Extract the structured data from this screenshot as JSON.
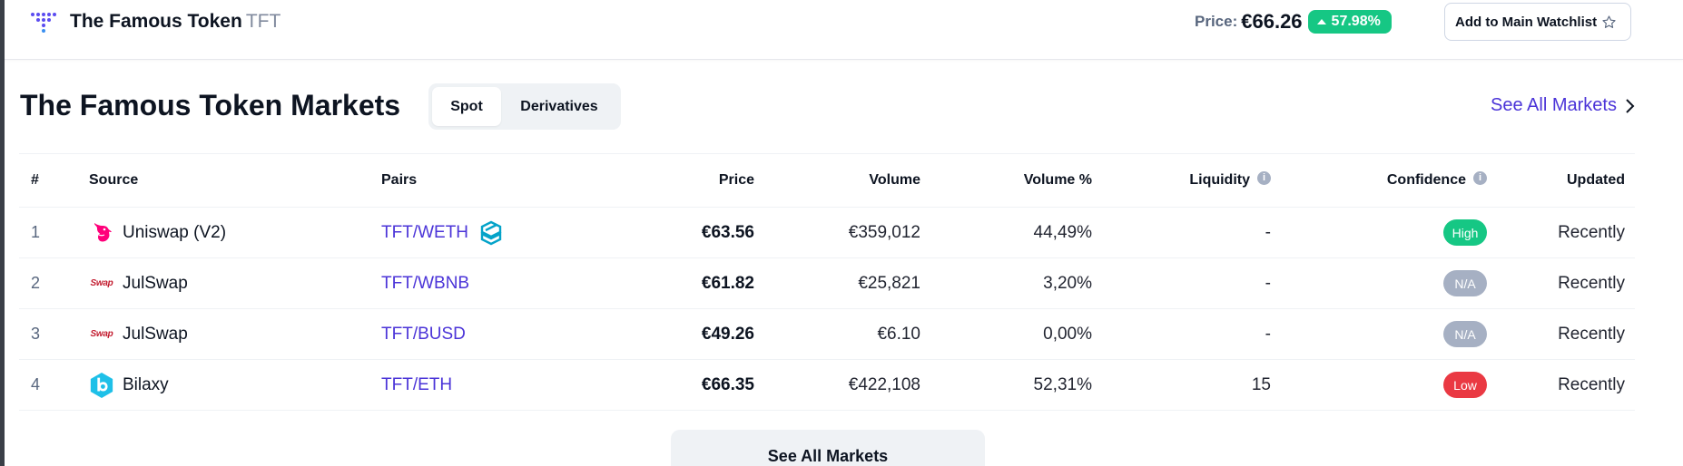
{
  "header": {
    "token_name": "The Famous Token",
    "token_symbol": "TFT",
    "price_label": "Price:",
    "price_value": "€66.26",
    "change_pct": "57.98%",
    "watchlist_label": "Add to Main Watchlist"
  },
  "markets": {
    "title": "The Famous Token Markets",
    "tabs": [
      {
        "label": "Spot",
        "active": true
      },
      {
        "label": "Derivatives",
        "active": false
      }
    ],
    "see_all_label": "See All Markets",
    "columns": {
      "num": "#",
      "source": "Source",
      "pairs": "Pairs",
      "price": "Price",
      "volume": "Volume",
      "volume_pct": "Volume %",
      "liquidity": "Liquidity",
      "confidence": "Confidence",
      "updated": "Updated"
    },
    "rows": [
      {
        "num": "1",
        "source": "Uniswap (V2)",
        "source_icon": "uniswap-unicorn-icon",
        "pair": "TFT/WETH",
        "pair_icon": "dextools-icon",
        "price": "€63.56",
        "volume": "€359,012",
        "volume_pct": "44,49%",
        "liquidity": "-",
        "confidence": "High",
        "confidence_color": "#16c784",
        "updated": "Recently"
      },
      {
        "num": "2",
        "source": "JulSwap",
        "source_icon": "julswap-logo",
        "source_logo_text": "Swap",
        "pair": "TFT/WBNB",
        "price": "€61.82",
        "volume": "€25,821",
        "volume_pct": "3,20%",
        "liquidity": "-",
        "confidence": "N/A",
        "confidence_color": "#a6b0c3",
        "updated": "Recently"
      },
      {
        "num": "3",
        "source": "JulSwap",
        "source_icon": "julswap-logo",
        "source_logo_text": "Swap",
        "pair": "TFT/BUSD",
        "price": "€49.26",
        "volume": "€6.10",
        "volume_pct": "0,00%",
        "liquidity": "-",
        "confidence": "N/A",
        "confidence_color": "#a6b0c3",
        "updated": "Recently"
      },
      {
        "num": "4",
        "source": "Bilaxy",
        "source_icon": "bilaxy-b-icon",
        "pair": "TFT/ETH",
        "price": "€66.35",
        "volume": "€422,108",
        "volume_pct": "52,31%",
        "liquidity": "15",
        "confidence": "Low",
        "confidence_color": "#ea3943",
        "updated": "Recently"
      }
    ],
    "bottom_button_label": "See All Markets"
  },
  "colors": {
    "positive": "#16c784",
    "negative": "#ea3943",
    "link": "#4b34d8",
    "neutral_badge": "#a6b0c3"
  }
}
